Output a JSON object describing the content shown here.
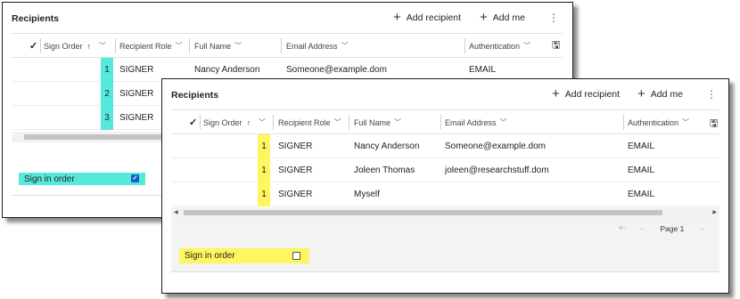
{
  "back_panel": {
    "title": "Recipients",
    "add_recipient_label": "Add recipient",
    "add_me_label": "Add me",
    "columns": {
      "sign_order": "Sign Order",
      "recipient_role": "Recipient Role",
      "full_name": "Full Name",
      "email": "Email Address",
      "authentication": "Authentication"
    },
    "rows": [
      {
        "order": "1",
        "role": "SIGNER",
        "name": "Nancy Anderson",
        "email": "Someone@example.dom",
        "auth": "EMAIL"
      },
      {
        "order": "2",
        "role": "SIGNER"
      },
      {
        "order": "3",
        "role": "SIGNER"
      }
    ],
    "sign_in_order_label": "Sign in order",
    "sign_in_order_checked": true,
    "highlight_color": "#55e8dc"
  },
  "front_panel": {
    "title": "Recipients",
    "add_recipient_label": "Add recipient",
    "add_me_label": "Add me",
    "columns": {
      "sign_order": "Sign Order",
      "recipient_role": "Recipient Role",
      "full_name": "Full Name",
      "email": "Email Address",
      "authentication": "Authentication"
    },
    "rows": [
      {
        "order": "1",
        "role": "SIGNER",
        "name": "Nancy Anderson",
        "email": "Someone@example.dom",
        "auth": "EMAIL"
      },
      {
        "order": "1",
        "role": "SIGNER",
        "name": "Joleen Thomas",
        "email": "joleen@researchstuff.dom",
        "auth": "EMAIL"
      },
      {
        "order": "1",
        "role": "SIGNER",
        "name": "Myself",
        "email": "",
        "auth": "EMAIL"
      }
    ],
    "page_label": "Page 1",
    "sign_in_order_label": "Sign in order",
    "sign_in_order_checked": false,
    "highlight_color": "#fff55e"
  },
  "icons": {
    "plus": "+",
    "kebab": "⋮",
    "check": "✓",
    "sort_up": "↑",
    "chevron_down": "﹀",
    "save": "🖫",
    "first_page": "⇤",
    "prev_page": "←",
    "next_page": "→",
    "scroll_left": "◀",
    "scroll_right": "▶"
  }
}
